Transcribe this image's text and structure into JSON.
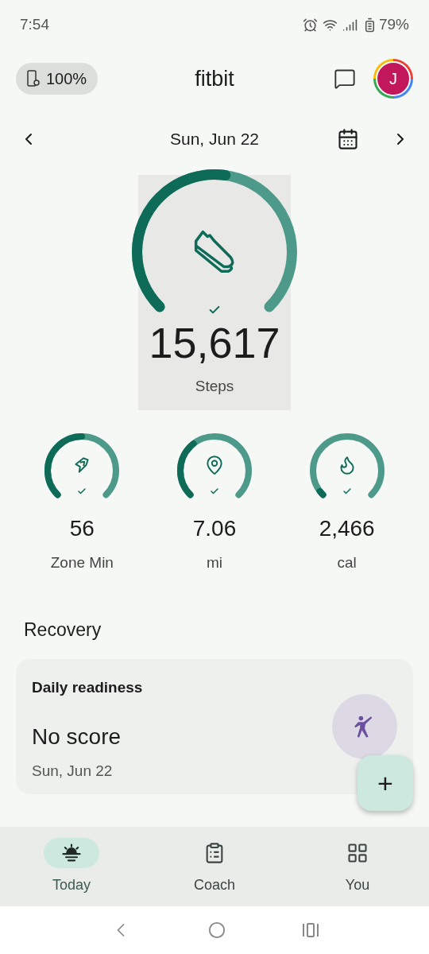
{
  "status_bar": {
    "time": "7:54",
    "battery": "79%"
  },
  "header": {
    "device_battery": "100%",
    "title": "fitbit",
    "avatar_letter": "J"
  },
  "date_nav": {
    "date": "Sun, Jun 22"
  },
  "main_stat": {
    "value": "15,617",
    "label": "Steps",
    "goal_met": true
  },
  "stats": [
    {
      "kind": "zone",
      "value": "56",
      "label": "Zone Min",
      "goal_met": true
    },
    {
      "kind": "distance",
      "value": "7.06",
      "label": "mi",
      "goal_met": true
    },
    {
      "kind": "calories",
      "value": "2,466",
      "label": "cal",
      "goal_met": true
    }
  ],
  "section_title": "Recovery",
  "readiness_card": {
    "title": "Daily readiness",
    "score": "No score",
    "date": "Sun, Jun 22"
  },
  "fab": "+",
  "bottom_nav": [
    {
      "kind": "today",
      "label": "Today",
      "selected": true
    },
    {
      "kind": "coach",
      "label": "Coach",
      "selected": false
    },
    {
      "kind": "you",
      "label": "You",
      "selected": false
    }
  ]
}
